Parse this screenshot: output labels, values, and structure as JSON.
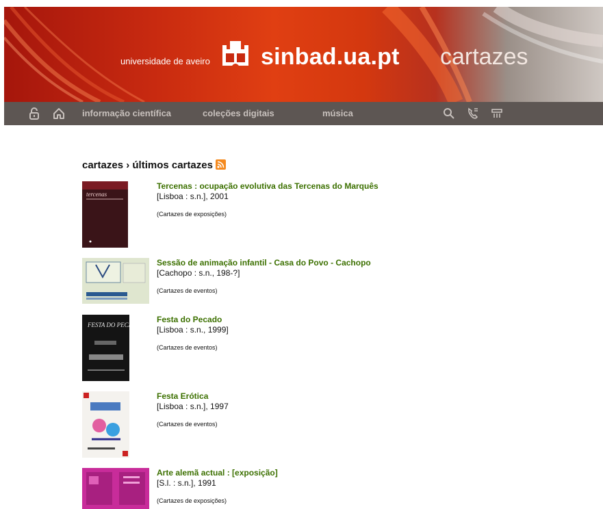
{
  "header": {
    "university": "universidade de aveiro",
    "site": "sinbad.ua.pt",
    "section": "cartazes"
  },
  "nav": {
    "links": [
      "informação científica",
      "coleções digitais",
      "música"
    ]
  },
  "breadcrumb": "cartazes › últimos cartazes",
  "items": [
    {
      "title": "Tercenas : ocupação evolutiva das Tercenas do Marquês",
      "publication": "[Lisboa : s.n.], 2001",
      "collection": "(Cartazes de exposições)",
      "thumb_text": "tercenas"
    },
    {
      "title": "Sessão de animação infantil - Casa do Povo - Cachopo",
      "publication": "[Cachopo : s.n., 198-?]",
      "collection": "(Cartazes de eventos)"
    },
    {
      "title": "Festa do Pecado",
      "publication": "[Lisboa : s.n., 1999]",
      "collection": "(Cartazes de eventos)",
      "thumb_text": "FESTA DO PECADO"
    },
    {
      "title": "Festa Erótica",
      "publication": "[Lisboa : s.n.], 1997",
      "collection": "(Cartazes de eventos)"
    },
    {
      "title": "Arte alemã actual : [exposição]",
      "publication": "[S.l. : s.n.], 1991",
      "collection": "(Cartazes de exposições)"
    }
  ],
  "colors": {
    "title_green": "#3c7000",
    "nav_bg": "#5d5653",
    "banner_red": "#c82a10",
    "rss_orange": "#f58a1f"
  }
}
